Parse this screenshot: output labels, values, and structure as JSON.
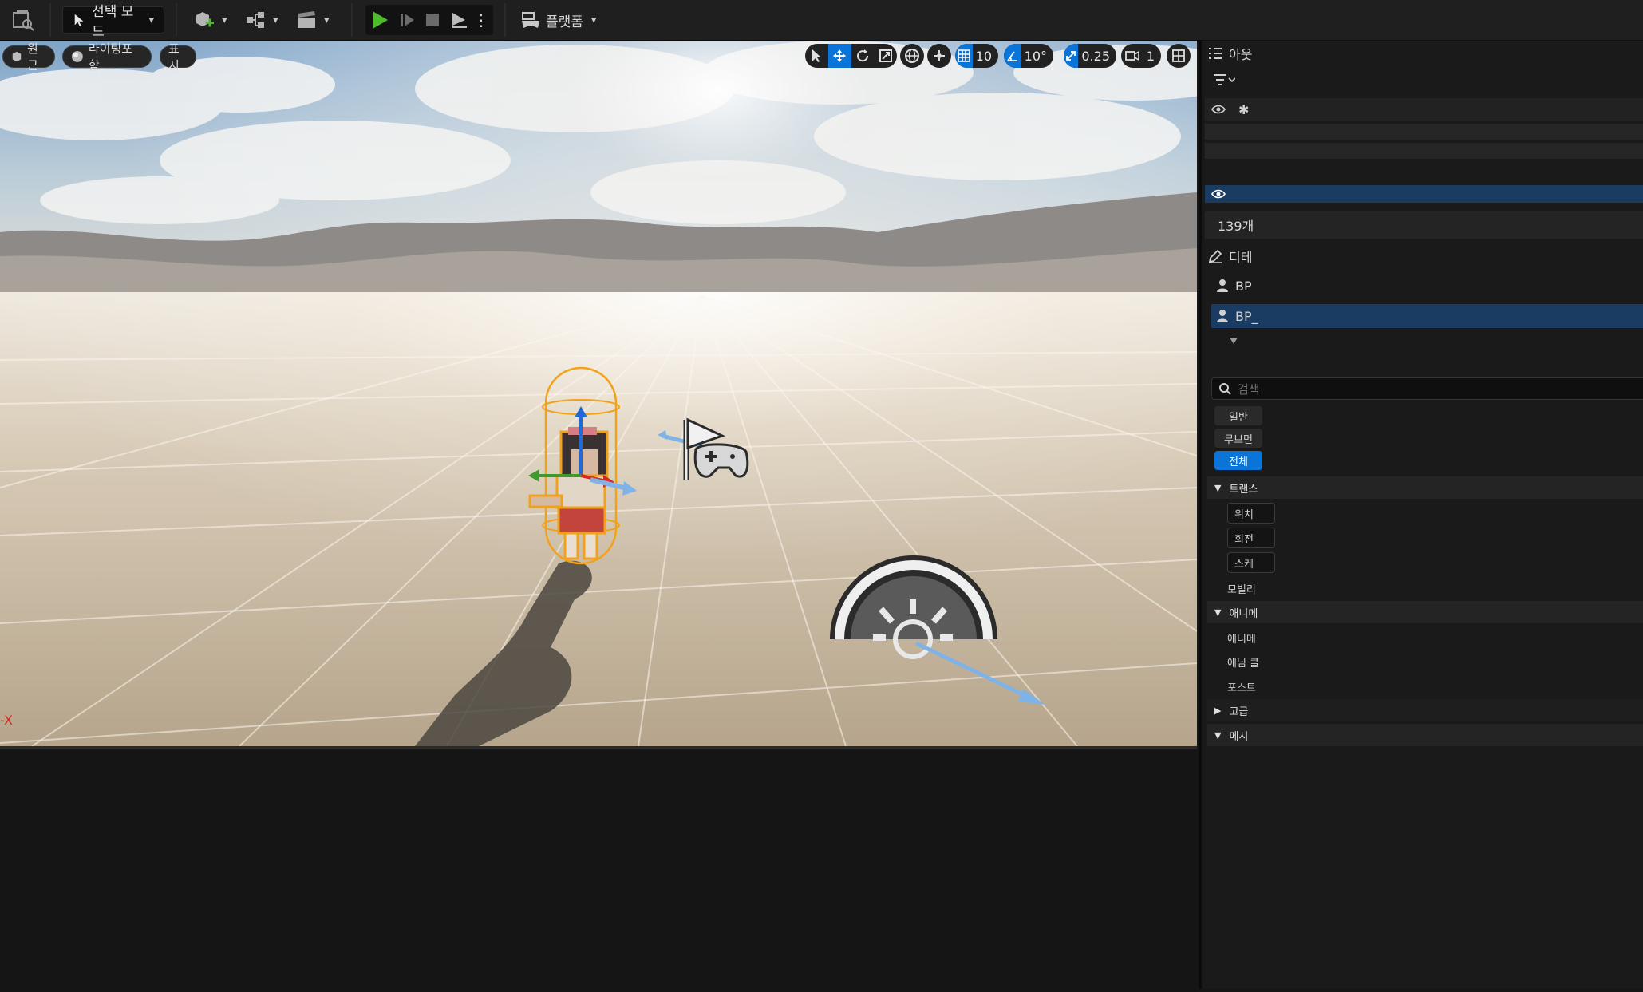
{
  "toolbar": {
    "select_mode_label": "선택 모드",
    "platform_label": "플랫폼"
  },
  "viewport": {
    "view_mode": "원근",
    "lit_mode": "라이팅포함",
    "show_label": "표시",
    "grid_snap_value": "10",
    "rotation_snap_value": "10°",
    "scale_snap_value": "0.25",
    "camera_speed_value": "1",
    "axis_label": "-X"
  },
  "outliner": {
    "tab_label": "아웃",
    "item_count": "139개"
  },
  "details": {
    "tab_label": "디테",
    "actor_name": "BP",
    "component_name": "BP_",
    "search_placeholder": "검색",
    "filter_buttons": [
      "일반",
      "무브먼",
      "전체"
    ],
    "sections": {
      "transform": "트랜스",
      "location": "위치",
      "rotation": "회전",
      "scale": "스케",
      "mobility": "모빌리",
      "animation": "애니메",
      "anim_mode": "애니메",
      "anim_class": "애님 클",
      "post_process": "포스트",
      "advanced": "고급",
      "mesh": "메시"
    }
  },
  "colors": {
    "accent": "#0a74d8",
    "play_green": "#4fbb2c",
    "selection_orange": "#f2a219"
  }
}
